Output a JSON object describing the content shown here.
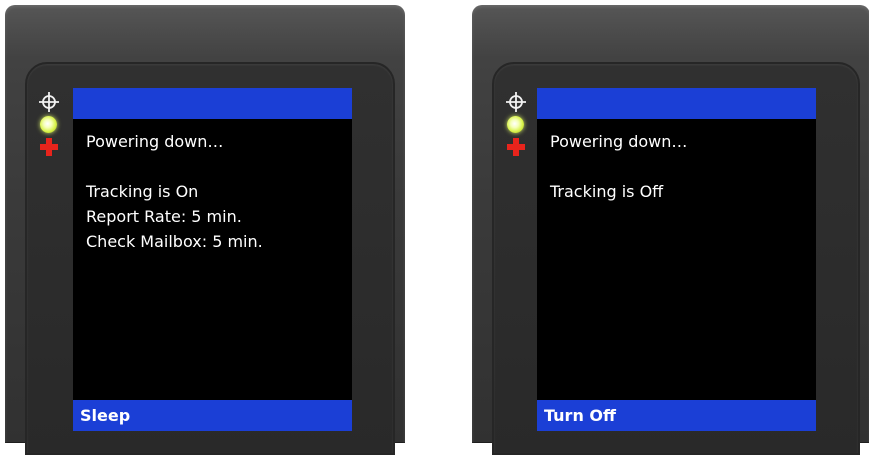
{
  "devices": [
    {
      "message": "Powering down…",
      "status_lines": [
        "Tracking is On",
        "Report Rate: 5 min.",
        "Check Mailbox: 5 min."
      ],
      "softkey": "Sleep"
    },
    {
      "message": "Powering down…",
      "status_lines": [
        "Tracking is Off"
      ],
      "softkey": "Turn Off"
    }
  ],
  "icons": [
    "crosshair-icon",
    "status-led-icon",
    "red-cross-icon"
  ],
  "colors": {
    "screen_bar_blue": "#1b3fd6",
    "screen_background": "#000000",
    "text": "#ffffff",
    "led_yellow_green": "#d8f24a",
    "cross_red": "#e8241c",
    "device_body": "#3a3a3a"
  }
}
